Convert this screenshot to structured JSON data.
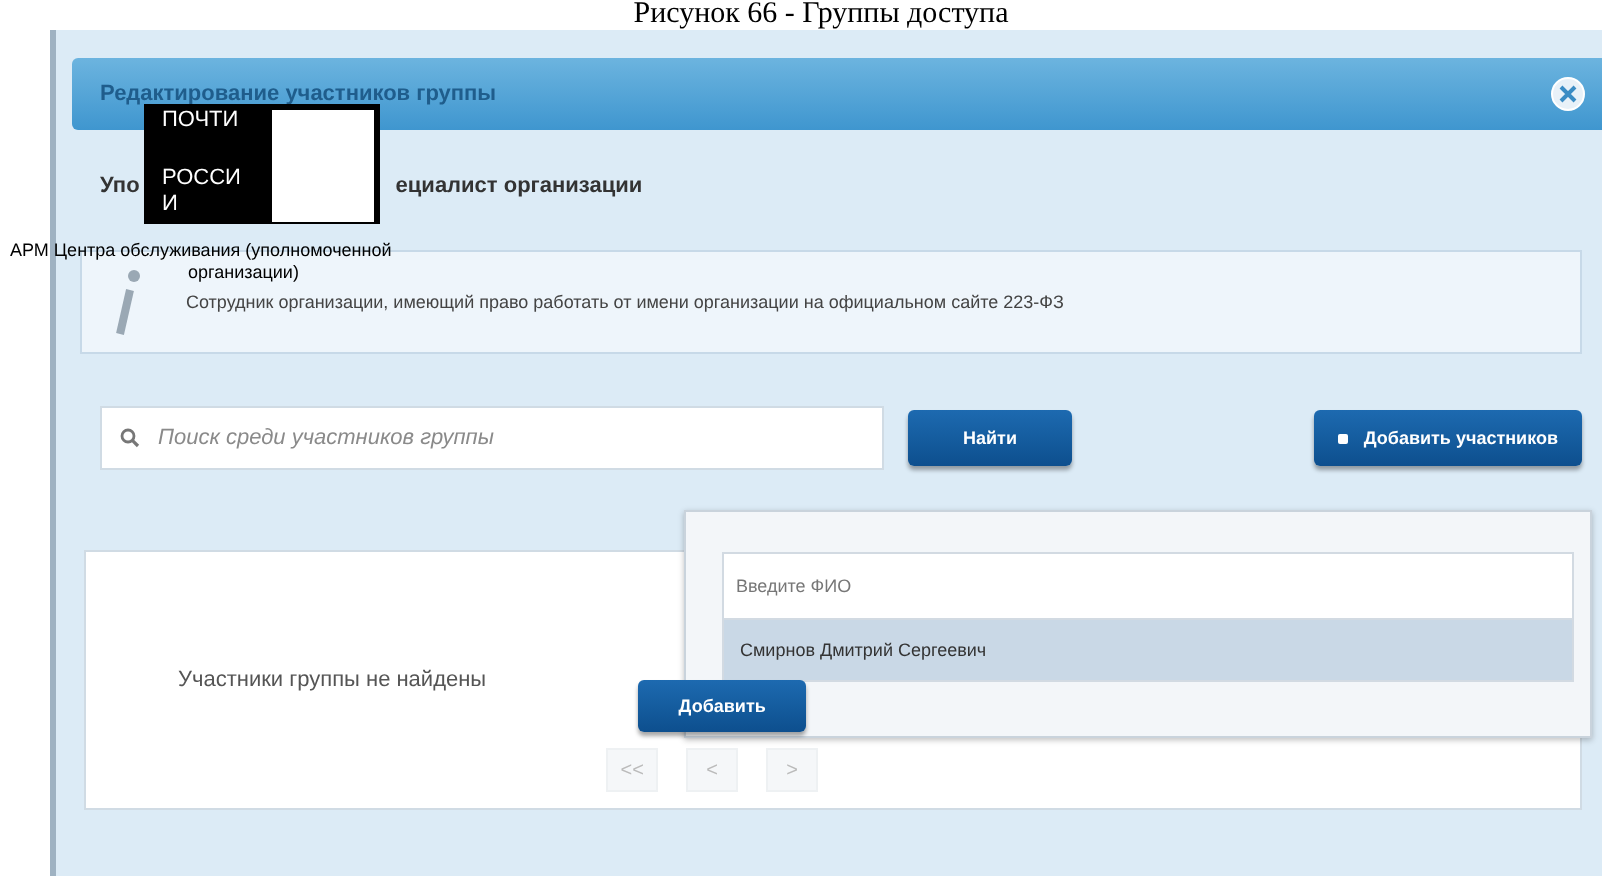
{
  "caption": "Рисунок 66 - Группы доступа",
  "dialog": {
    "title": "Редактирование участников группы",
    "role_title": [
      "Упо",
      "ециалист организации"
    ],
    "info": "Сотрудник организации, имеющий право работать от имени организации на официальном сайте 223-ФЗ",
    "search": {
      "placeholder": "Поиск среди участников группы"
    },
    "find_button": "Найти",
    "add_members_button": "Добавить участников",
    "empty_message": "Участники группы не найдены",
    "add_button": "Добавить",
    "pagination": [
      "<<",
      "<",
      ">"
    ],
    "popup": {
      "field": {
        "placeholder": "Введите ФИО"
      },
      "suggestions": [
        {
          "text": "Смирнов Дмитрий Сергеевич",
          "selected": true
        }
      ]
    }
  },
  "overlay": {
    "badge_lines": [
      "ПОЧТИ",
      "РОССИ",
      "И"
    ],
    "note_lines": [
      "АРМ Центра обслуживания (уполномоченной",
      "организации)"
    ]
  }
}
